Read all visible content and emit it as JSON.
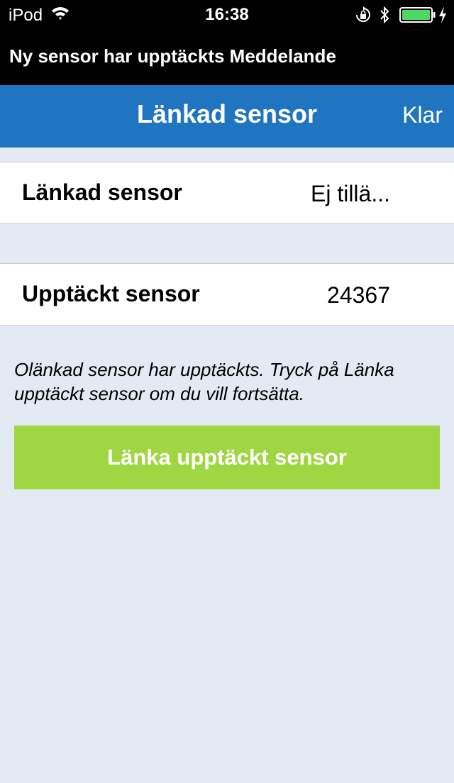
{
  "status_bar": {
    "carrier": "iPod",
    "time": "16:38",
    "icons": [
      "wifi-icon",
      "orientation-lock-icon",
      "bluetooth-icon",
      "battery-icon",
      "charging-icon"
    ],
    "battery_color": "#4cd964"
  },
  "notification": {
    "text": "Ny sensor har upptäckts Meddelande"
  },
  "nav": {
    "title": "Länkad sensor",
    "done_label": "Klar",
    "color": "#2075c0"
  },
  "rows": [
    {
      "label": "Länkad sensor",
      "value": "Ej tillä..."
    },
    {
      "label": "Upptäckt sensor",
      "value": "24367"
    }
  ],
  "info": {
    "text": "Olänkad sensor har upptäckts. Tryck på Länka upptäckt sensor om du vill fortsätta."
  },
  "action": {
    "label": "Länka upptäckt sensor",
    "color": "#a1d643"
  }
}
